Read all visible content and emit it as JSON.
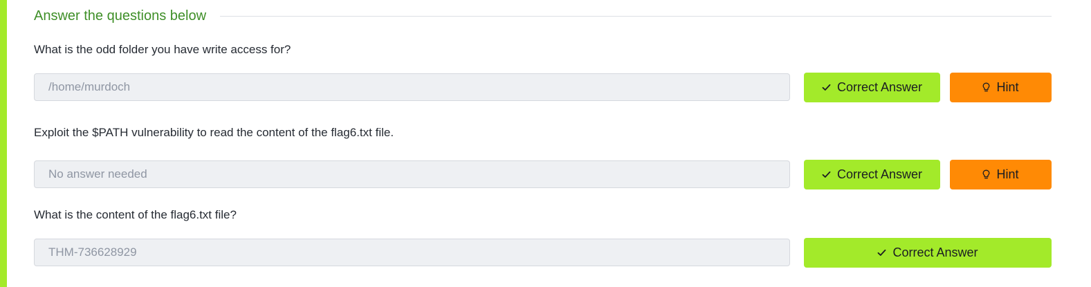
{
  "section": {
    "title": "Answer the questions below"
  },
  "questions": [
    {
      "text": "What is the odd folder you have write access for?",
      "answer": "/home/murdoch",
      "submit_label": "Correct Answer",
      "hint_label": "Hint",
      "submit_icon": "check-icon",
      "hint_icon": "lightbulb-icon"
    },
    {
      "text": "Exploit the $PATH vulnerability to read the content of the flag6.txt file.",
      "answer": "No answer needed",
      "submit_label": "Correct Answer",
      "hint_label": "Hint",
      "submit_icon": "check-icon",
      "hint_icon": "lightbulb-icon"
    },
    {
      "text": "What is the content of the flag6.txt file?",
      "answer": "THM-736628929",
      "submit_label": "Correct Answer",
      "submit_icon": "check-icon"
    }
  ],
  "colors": {
    "accent": "#a3ea2a",
    "hint": "#ff8a05",
    "title": "#3f8f28",
    "field_bg": "#eef0f3"
  }
}
